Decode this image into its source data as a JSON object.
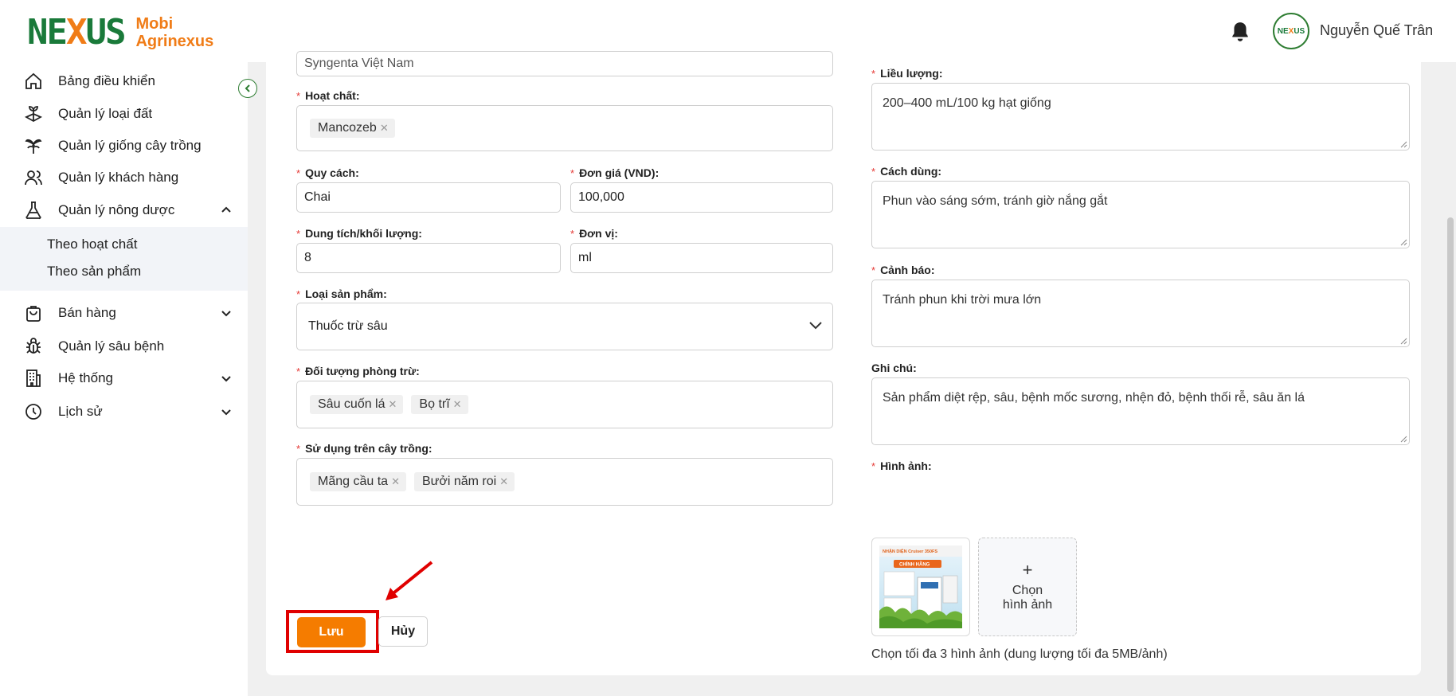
{
  "header": {
    "logo_mark": "NEXUS",
    "logo_line1": "Mobi",
    "logo_line2": "Agrinexus",
    "avatar_text": "NEXUS",
    "user_name": "Nguyễn Quế Trân"
  },
  "sidebar": {
    "items": [
      {
        "label": "Bảng điều khiển",
        "icon": "home-icon"
      },
      {
        "label": "Quản lý loại đất",
        "icon": "soil-icon"
      },
      {
        "label": "Quản lý giống cây trồng",
        "icon": "plant-icon"
      },
      {
        "label": "Quản lý khách hàng",
        "icon": "users-icon"
      },
      {
        "label": "Quản lý nông dược",
        "icon": "flask-icon",
        "expanded": true
      },
      {
        "label": "Bán hàng",
        "icon": "shopping-bag-icon"
      },
      {
        "label": "Quản lý sâu bệnh",
        "icon": "bug-icon"
      },
      {
        "label": "Hệ thống",
        "icon": "building-icon"
      },
      {
        "label": "Lịch sử",
        "icon": "clock-icon"
      }
    ],
    "subitems": [
      "Theo hoạt chất",
      "Theo sản phẩm"
    ]
  },
  "form": {
    "manufacturer_value": "Syngenta Việt Nam",
    "active_ingredient": {
      "label": "Hoạt chất:",
      "tags": [
        "Mancozeb"
      ]
    },
    "packaging": {
      "label": "Quy cách:",
      "value": "Chai"
    },
    "unit_price": {
      "label": "Đơn giá (VND):",
      "value": "100,000"
    },
    "volume": {
      "label": "Dung tích/khối lượng:",
      "value": "8"
    },
    "unit": {
      "label": "Đơn vị:",
      "value": "ml"
    },
    "product_type": {
      "label": "Loại sản phẩm:",
      "value": "Thuốc trừ sâu"
    },
    "targets": {
      "label": "Đối tượng phòng trừ:",
      "tags": [
        "Sâu cuốn lá",
        "Bọ trĩ"
      ]
    },
    "crops": {
      "label": "Sử dụng trên cây trồng:",
      "tags": [
        "Mãng cầu ta",
        "Bưởi năm roi"
      ]
    },
    "dosage": {
      "label": "Liều lượng:",
      "value": "200–400 mL/100 kg hạt giống"
    },
    "usage": {
      "label": "Cách dùng:",
      "value": "Phun vào sáng sớm, tránh giờ nắng gắt"
    },
    "warning": {
      "label": "Cảnh báo:",
      "value": "Tránh phun khi trời mưa lớn"
    },
    "notes": {
      "label": "Ghi chú:",
      "value": "Sản phẩm diệt rệp, sâu, bệnh mốc sương, nhện đỏ, bệnh thối rễ, sâu ăn lá"
    },
    "images": {
      "label": "Hình ảnh:",
      "upload_line1": "Chọn",
      "upload_line2": "hình ảnh",
      "hint": "Chọn tối đa 3 hình ảnh (dung lượng tối đa 5MB/ảnh)",
      "thumb_text1": "NHẬN DIỆN Cruiser 350FS",
      "thumb_text2": "CHÍNH HÃNG"
    }
  },
  "actions": {
    "save": "Lưu",
    "cancel": "Hủy"
  },
  "colors": {
    "brand_orange": "#f57c00",
    "brand_green": "#1a7a3a",
    "required": "#e53935",
    "annotation_red": "#e00000"
  }
}
